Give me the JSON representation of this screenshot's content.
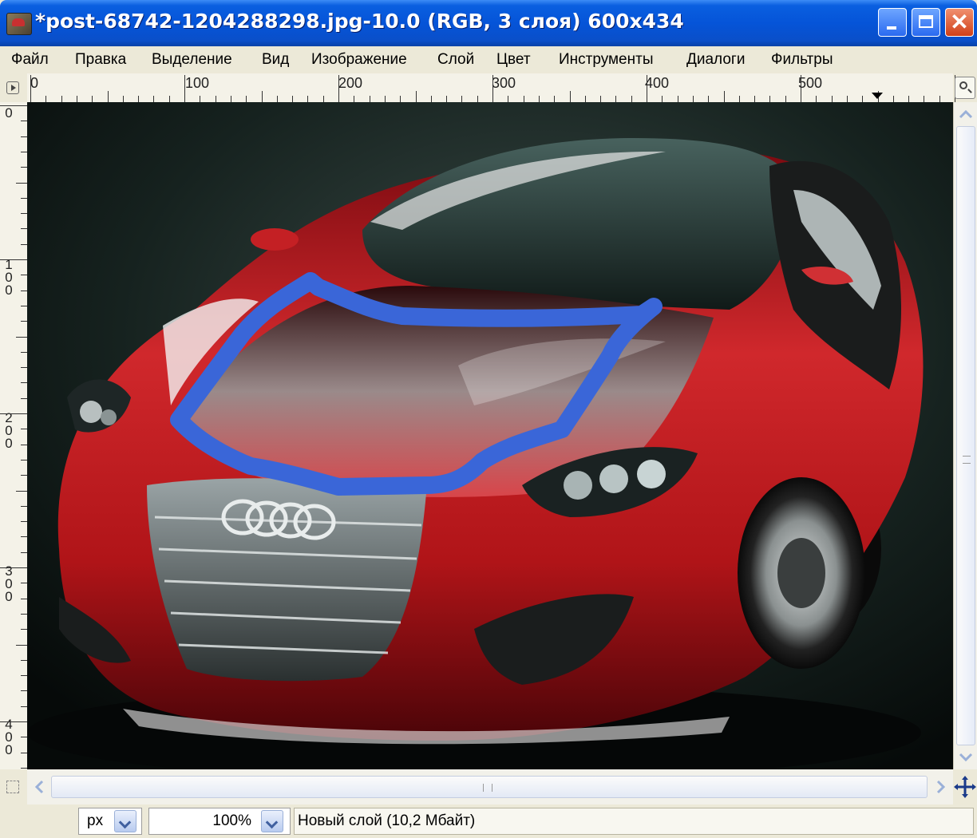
{
  "window": {
    "title": "*post-68742-1204288298.jpg-10.0 (RGB, 3 слоя) 600x434",
    "close_glyph": "✕"
  },
  "menu": {
    "items": [
      "Файл",
      "Правка",
      "Выделение",
      "Вид",
      "Изображение",
      "Слой",
      "Цвет",
      "Инструменты",
      "Диалоги",
      "Фильтры"
    ]
  },
  "ruler": {
    "h_labels": [
      "0",
      "100",
      "200",
      "300",
      "400",
      "500"
    ],
    "v_labels": [
      "0",
      "100",
      "200",
      "300",
      "400"
    ]
  },
  "canvas": {
    "description_colors": {
      "body": "#c0181c",
      "background": "#0e1a18",
      "stroke": "#3a66d8"
    }
  },
  "status": {
    "unit": "px",
    "zoom": "100%",
    "message": "Новый слой (10,2 Мбайт)"
  },
  "icons": [
    "gimp-window-icon",
    "minimize-icon",
    "maximize-icon",
    "close-icon",
    "menu-triangle-icon",
    "zoom-icon",
    "quickmask-icon",
    "navigate-icon",
    "chevron-down-icon"
  ]
}
